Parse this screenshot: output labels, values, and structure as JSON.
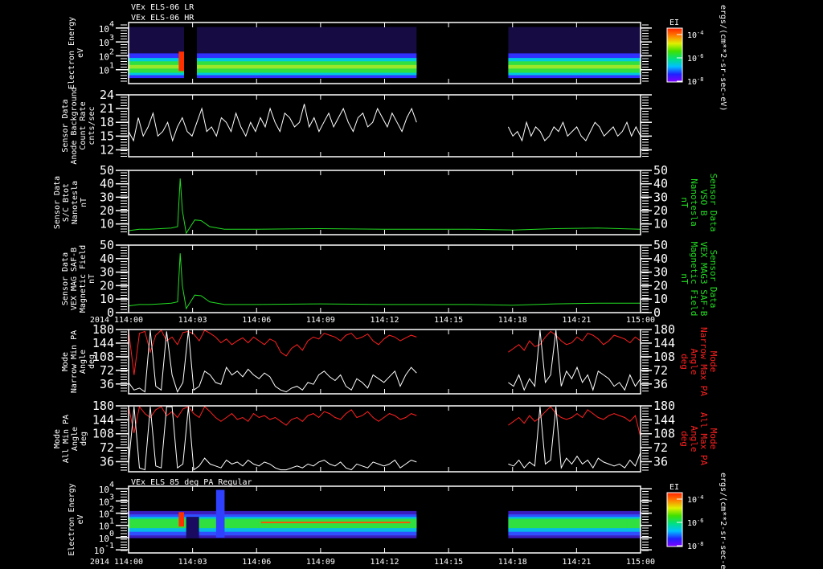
{
  "titles": {
    "p1_line1": "VEx ELS-06 LR",
    "p1_line2": "VEx ELS-06 HR",
    "p7": "VEx ELS 85 deg PA Regular"
  },
  "colorbar": {
    "label": "EI",
    "ticks": [
      {
        "base": "10",
        "exp": "-4"
      },
      {
        "base": "10",
        "exp": "-6"
      },
      {
        "base": "10",
        "exp": "-8"
      }
    ],
    "units": "ergs/(cm**2-sr-sec-eV)"
  },
  "time_axis": {
    "year": "2014",
    "labels": [
      "114:00",
      "114:03",
      "114:06",
      "114:09",
      "114:12",
      "114:15",
      "114:18",
      "114:21",
      "115:00"
    ],
    "hours": [
      0,
      3,
      6,
      9,
      12,
      15,
      18,
      21,
      24
    ]
  },
  "chart_data": [
    {
      "id": "p1",
      "type": "heatmap",
      "ylabel": [
        "Electron Energy",
        "eV"
      ],
      "yscale": "log",
      "ylim": [
        1,
        25000
      ],
      "yticks": [
        {
          "v": 10000,
          "base": "10",
          "exp": "4"
        },
        {
          "v": 1000,
          "base": "10",
          "exp": "3"
        },
        {
          "v": 100,
          "base": "10",
          "exp": "2"
        },
        {
          "v": 10,
          "base": "10",
          "exp": "1"
        }
      ],
      "segments": [
        [
          0,
          13.5
        ],
        [
          17.8,
          24
        ]
      ],
      "bands": [
        {
          "emin": 3,
          "emax": 12000,
          "color": "#4020c0",
          "opacity": 0.35
        },
        {
          "emin": 2.5,
          "emax": 150,
          "color": "#3030ff",
          "opacity": 1
        },
        {
          "emin": 4,
          "emax": 70,
          "color": "#00c8e0",
          "opacity": 1
        },
        {
          "emin": 6,
          "emax": 40,
          "color": "#30e040",
          "opacity": 1
        },
        {
          "emin": 12,
          "emax": 22,
          "color": "#c8e820",
          "opacity": 0.7
        }
      ],
      "hotspots": [
        {
          "t0": 2.35,
          "t1": 2.6,
          "emin": 8,
          "emax": 200,
          "color": "#ff3000"
        },
        {
          "t0": 2.6,
          "t1": 3.2,
          "emin": 1,
          "emax": 25000,
          "color": "#000000"
        }
      ]
    },
    {
      "id": "p2",
      "type": "line",
      "ylabel": [
        "Sensor Data",
        "Anode Background",
        "Count Rate",
        "cnts/sec"
      ],
      "ylim": [
        10.5,
        24
      ],
      "yticks": [
        24,
        21,
        18,
        15,
        12
      ],
      "series": [
        {
          "name": "count rate",
          "color": "#ffffff",
          "segments": [
            {
              "t0": 0,
              "t1": 13.5,
              "values": [
                16,
                14,
                19,
                15,
                17,
                20,
                15,
                16,
                18,
                14,
                17,
                19,
                16,
                15,
                18,
                21,
                16,
                17,
                15,
                19,
                18,
                16,
                20,
                17,
                15,
                18,
                16,
                19,
                17,
                21,
                18,
                16,
                20,
                19,
                17,
                18,
                22,
                17,
                19,
                16,
                18,
                20,
                17,
                19,
                21,
                18,
                16,
                19,
                20,
                17,
                18,
                21,
                19,
                17,
                20,
                18,
                16,
                19,
                21,
                18
              ]
            },
            {
              "t0": 17.8,
              "t1": 24,
              "values": [
                17,
                15,
                16,
                14,
                18,
                15,
                17,
                16,
                14,
                15,
                17,
                16,
                18,
                15,
                16,
                17,
                15,
                14,
                16,
                18,
                17,
                15,
                16,
                17,
                15,
                16,
                18,
                15,
                17,
                15
              ]
            }
          ]
        }
      ]
    },
    {
      "id": "p3",
      "type": "line",
      "ylabel": [
        "Sensor Data",
        "S/C Btot",
        "Nanotesla",
        "nT"
      ],
      "ylabel_right": [
        "Sensor Data",
        "VSO B",
        "Nanotesla",
        "nT"
      ],
      "ylim": [
        2,
        50
      ],
      "yticks": [
        50,
        40,
        30,
        20,
        10
      ],
      "series": [
        {
          "name": "VSO B",
          "color": "#22dd22",
          "points": [
            [
              0,
              5
            ],
            [
              0.5,
              6
            ],
            [
              1,
              6
            ],
            [
              1.5,
              6.5
            ],
            [
              2,
              7
            ],
            [
              2.3,
              8
            ],
            [
              2.42,
              44
            ],
            [
              2.52,
              20
            ],
            [
              2.7,
              3
            ],
            [
              2.9,
              8
            ],
            [
              3.1,
              13
            ],
            [
              3.4,
              12.5
            ],
            [
              3.8,
              8
            ],
            [
              4.5,
              6
            ],
            [
              6,
              6
            ],
            [
              9,
              6.5
            ],
            [
              12,
              6
            ],
            [
              13.5,
              6
            ],
            [
              16,
              6
            ],
            [
              18,
              5.5
            ],
            [
              20,
              6.5
            ],
            [
              22,
              7
            ],
            [
              24,
              6
            ]
          ]
        }
      ]
    },
    {
      "id": "p4",
      "type": "line",
      "ylabel": [
        "Sensor Data",
        "VEX MAG SAF-B",
        "Magnetic Field",
        "nT"
      ],
      "ylabel_right": [
        "Sensor Data",
        "VEX MAG3 SAF-B",
        "Magnetic Field",
        "nT"
      ],
      "ylim": [
        0,
        50
      ],
      "yticks": [
        50,
        40,
        30,
        20,
        10,
        0
      ],
      "series": [
        {
          "name": "SAF-B",
          "color": "#22dd22",
          "points": [
            [
              0,
              5
            ],
            [
              0.5,
              6
            ],
            [
              1,
              6
            ],
            [
              1.5,
              6.5
            ],
            [
              2,
              7
            ],
            [
              2.3,
              8
            ],
            [
              2.42,
              44
            ],
            [
              2.52,
              20
            ],
            [
              2.7,
              3
            ],
            [
              2.9,
              8
            ],
            [
              3.1,
              13
            ],
            [
              3.4,
              12.5
            ],
            [
              3.8,
              8
            ],
            [
              4.5,
              6
            ],
            [
              6,
              6
            ],
            [
              9,
              6.5
            ],
            [
              12,
              6
            ],
            [
              13.5,
              6
            ],
            [
              16,
              6
            ],
            [
              18,
              5.5
            ],
            [
              20,
              6.5
            ],
            [
              22,
              7
            ],
            [
              24,
              7
            ]
          ]
        }
      ]
    },
    {
      "id": "p5",
      "type": "line",
      "ylabel": [
        "Mode",
        "Narrow Min PA",
        "Angle",
        "deg"
      ],
      "ylabel_right": [
        "Mode",
        "Narrow Max PA",
        "Angle",
        "deg"
      ],
      "ylim": [
        10,
        180
      ],
      "yticks": [
        180,
        144,
        108,
        72,
        36
      ],
      "series": [
        {
          "name": "Max PA",
          "color": "#ff2020",
          "segments": [
            {
              "t0": 0,
              "t1": 13.5,
              "values": [
                178,
                60,
                170,
                175,
                120,
                165,
                178,
                150,
                160,
                140,
                172,
                175,
                168,
                150,
                178,
                170,
                160,
                145,
                155,
                140,
                150,
                158,
                145,
                160,
                150,
                140,
                155,
                148,
                120,
                110,
                130,
                140,
                125,
                150,
                160,
                155,
                170,
                165,
                160,
                150,
                165,
                170,
                155,
                160,
                168,
                150,
                140,
                155,
                165,
                160,
                150,
                158,
                165,
                160
              ]
            },
            {
              "t0": 17.8,
              "t1": 24,
              "values": [
                120,
                130,
                140,
                125,
                150,
                135,
                140,
                160,
                175,
                165,
                150,
                140,
                145,
                160,
                150,
                170,
                165,
                155,
                140,
                150,
                165,
                160,
                155,
                145,
                160,
                150
              ]
            }
          ]
        },
        {
          "name": "Min PA",
          "color": "#ffffff",
          "segments": [
            {
              "t0": 0,
              "t1": 13.5,
              "values": [
                40,
                20,
                25,
                15,
                178,
                30,
                20,
                175,
                60,
                15,
                40,
                178,
                20,
                30,
                70,
                60,
                40,
                35,
                80,
                60,
                70,
                55,
                75,
                60,
                50,
                65,
                55,
                30,
                20,
                15,
                25,
                30,
                20,
                40,
                35,
                60,
                70,
                55,
                45,
                60,
                30,
                20,
                50,
                40,
                25,
                60,
                50,
                40,
                55,
                70,
                30,
                60,
                80,
                65
              ]
            },
            {
              "t0": 17.8,
              "t1": 24,
              "values": [
                40,
                30,
                60,
                20,
                50,
                30,
                178,
                40,
                60,
                178,
                30,
                70,
                50,
                80,
                40,
                60,
                20,
                70,
                60,
                50,
                30,
                40,
                20,
                60,
                30,
                50
              ]
            }
          ]
        }
      ]
    },
    {
      "id": "p6",
      "type": "line",
      "ylabel": [
        "Mode",
        "All Min PA",
        "Angle",
        "deg"
      ],
      "ylabel_right": [
        "Mode",
        "All Max PA",
        "Angle",
        "deg"
      ],
      "ylim": [
        10,
        180
      ],
      "yticks": [
        180,
        144,
        108,
        72,
        36
      ],
      "series": [
        {
          "name": "Max PA",
          "color": "#ff2020",
          "segments": [
            {
              "t0": 0,
              "t1": 13.5,
              "values": [
                178,
                110,
                178,
                160,
                150,
                170,
                178,
                155,
                165,
                150,
                172,
                178,
                160,
                150,
                178,
                165,
                150,
                140,
                150,
                160,
                145,
                150,
                140,
                160,
                150,
                155,
                145,
                150,
                140,
                130,
                145,
                150,
                140,
                155,
                160,
                150,
                165,
                160,
                150,
                145,
                160,
                170,
                150,
                155,
                165,
                150,
                140,
                150,
                160,
                155,
                145,
                150,
                160,
                155
              ]
            },
            {
              "t0": 17.8,
              "t1": 24,
              "values": [
                130,
                140,
                150,
                135,
                155,
                140,
                150,
                165,
                178,
                160,
                150,
                145,
                150,
                160,
                150,
                170,
                160,
                150,
                145,
                155,
                160,
                155,
                150,
                140,
                155,
                100
              ]
            }
          ]
        },
        {
          "name": "Min PA",
          "color": "#ffffff",
          "segments": [
            {
              "t0": 0,
              "t1": 13.5,
              "values": [
                30,
                178,
                20,
                15,
                178,
                25,
                20,
                178,
                178,
                20,
                30,
                178,
                15,
                25,
                45,
                30,
                25,
                20,
                40,
                30,
                35,
                25,
                40,
                30,
                25,
                35,
                30,
                20,
                15,
                15,
                20,
                25,
                20,
                30,
                25,
                35,
                40,
                30,
                25,
                35,
                20,
                15,
                30,
                25,
                20,
                35,
                30,
                25,
                30,
                40,
                20,
                30,
                40,
                35
              ]
            },
            {
              "t0": 17.8,
              "t1": 24,
              "values": [
                30,
                25,
                40,
                20,
                35,
                25,
                178,
                30,
                40,
                178,
                20,
                45,
                30,
                50,
                30,
                40,
                20,
                45,
                35,
                30,
                25,
                30,
                20,
                40,
                25,
                60
              ]
            }
          ]
        }
      ]
    },
    {
      "id": "p7",
      "type": "heatmap",
      "ylabel": [
        "Electron Energy",
        "eV"
      ],
      "yscale": "log",
      "ylim": [
        0.056,
        16000
      ],
      "yticks": [
        {
          "v": 10000,
          "base": "10",
          "exp": "4"
        },
        {
          "v": 1000,
          "base": "10",
          "exp": "3"
        },
        {
          "v": 100,
          "base": "10",
          "exp": "2"
        },
        {
          "v": 10,
          "base": "10",
          "exp": "1"
        },
        {
          "v": 1,
          "base": "10",
          "exp": "0"
        },
        {
          "v": 0.1,
          "base": "10",
          "exp": "-1"
        }
      ],
      "segments": [
        [
          0,
          13.5
        ],
        [
          17.8,
          24
        ]
      ],
      "bands": [
        {
          "emin": 0.9,
          "emax": 150,
          "color": "#4020d0",
          "opacity": 0.9
        },
        {
          "emin": 1.5,
          "emax": 80,
          "color": "#3050ff",
          "opacity": 1
        },
        {
          "emin": 3,
          "emax": 50,
          "color": "#00c8e0",
          "opacity": 0.9
        },
        {
          "emin": 6,
          "emax": 35,
          "color": "#30e040",
          "opacity": 1
        }
      ],
      "hotspots": [
        {
          "t0": 2.35,
          "t1": 2.6,
          "emin": 8,
          "emax": 120,
          "color": "#ff3000"
        },
        {
          "t0": 2.7,
          "t1": 3.3,
          "emin": 0.9,
          "emax": 50,
          "color": "#1a0a60"
        },
        {
          "t0": 6.2,
          "t1": 13.2,
          "emin": 15,
          "emax": 20,
          "color": "#ff5000"
        },
        {
          "t0": 4.1,
          "t1": 4.5,
          "emin": 1,
          "emax": 8000,
          "color": "#3040ff"
        }
      ]
    }
  ]
}
